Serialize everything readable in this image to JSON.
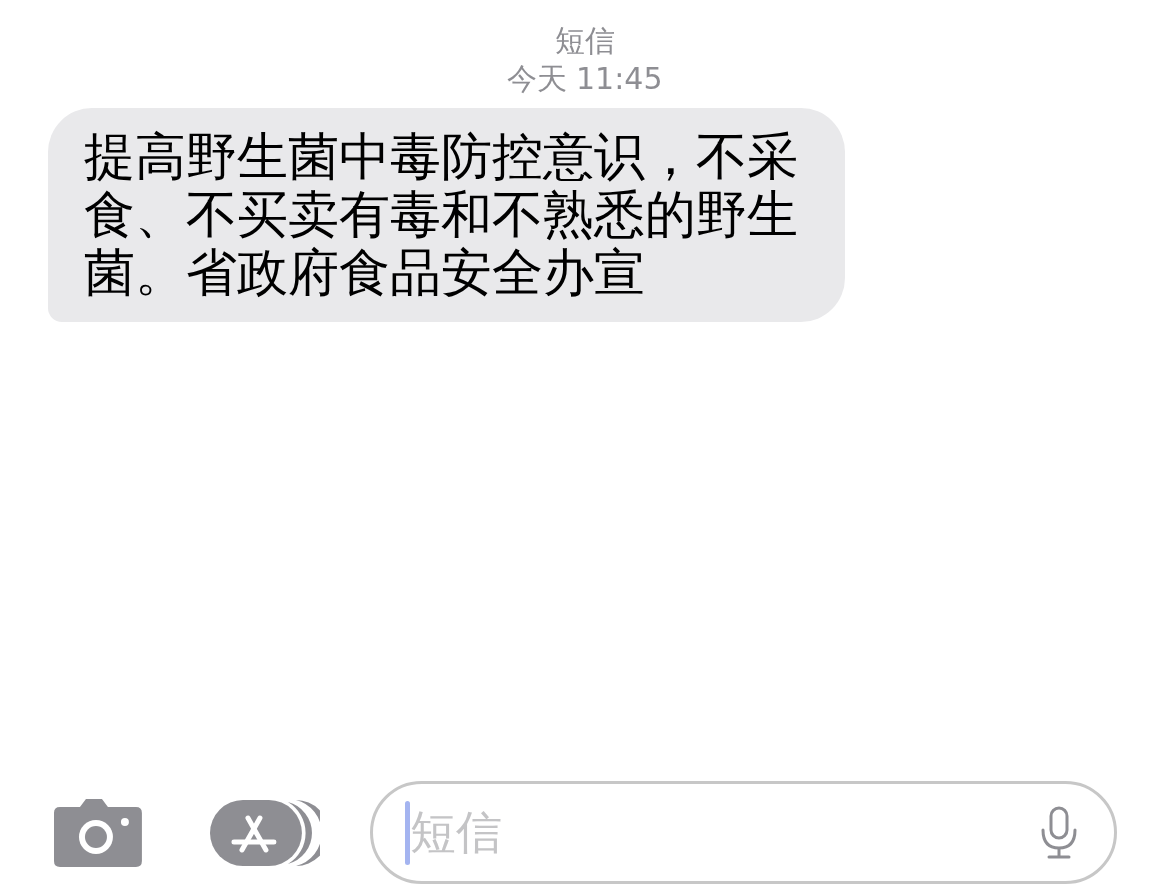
{
  "header": {
    "title": "短信",
    "timestamp": "今天 11:45"
  },
  "messages": [
    {
      "text": "提高野生菌中毒防控意识，不采食、不买卖有毒和不熟悉的野生菌。省政府食品安全办宣",
      "incoming": true
    }
  ],
  "composer": {
    "placeholder": "短信"
  }
}
